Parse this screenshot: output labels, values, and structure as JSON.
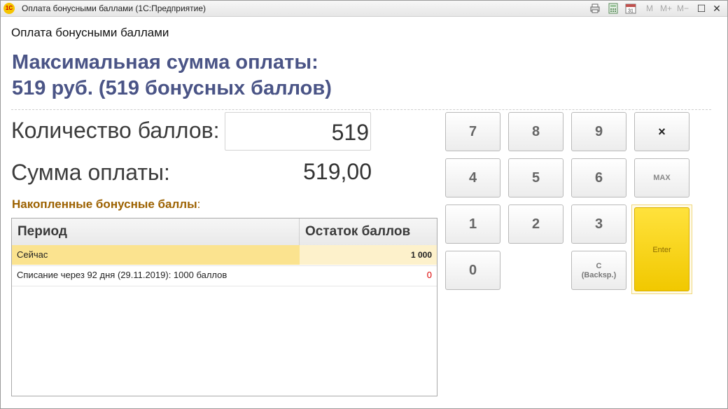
{
  "window": {
    "title": "Оплата бонусными баллами  (1С:Предприятие)",
    "app_icon": "1С",
    "toolbar_icons": [
      "print-icon",
      "calculator-icon",
      "calendar-icon"
    ],
    "calendar_day": "31",
    "memory_buttons": [
      "M",
      "M+",
      "M−"
    ],
    "controls": {
      "maximize": "☐",
      "close": "✕"
    }
  },
  "form": {
    "title": "Оплата бонусными баллами",
    "max_line1": "Максимальная сумма оплаты:",
    "max_line2": "519 руб. (519 бонусных баллов)",
    "points_label": "Количество баллов:",
    "points_value": "519",
    "sum_label": "Сумма оплаты:",
    "sum_value": "519,00",
    "accum_label": "Накопленные бонусные баллы",
    "accum_colon": ":"
  },
  "table": {
    "columns": [
      "Период",
      "Остаток баллов"
    ],
    "rows": [
      {
        "period": "Сейчас",
        "balance": "1 000"
      },
      {
        "period": "Списание через 92 дня (29.11.2019): 1000 баллов",
        "balance": "0"
      }
    ]
  },
  "keypad": {
    "k7": "7",
    "k8": "8",
    "k9": "9",
    "close": "×",
    "k4": "4",
    "k5": "5",
    "k6": "6",
    "max": "MAX",
    "k1": "1",
    "k2": "2",
    "k3": "3",
    "enter": "Enter",
    "k0": "0",
    "clear_line1": "C",
    "clear_line2": "(Backsp.)"
  },
  "colors": {
    "heading": "#4a5486",
    "accum_label": "#9c6100",
    "selected_row": "#fbe38f",
    "enter_button": "#ffe23c",
    "negative": "#dd0000"
  }
}
